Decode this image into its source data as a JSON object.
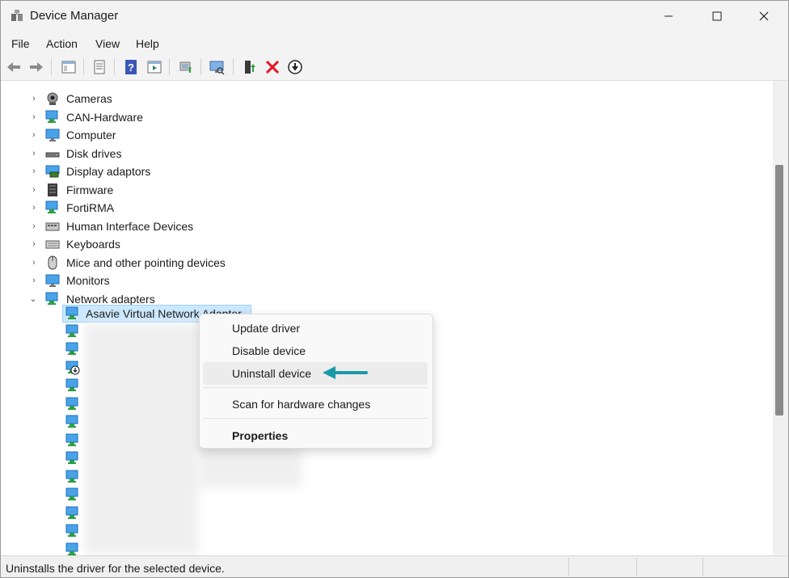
{
  "window": {
    "title": "Device Manager"
  },
  "menu": [
    "File",
    "Action",
    "View",
    "Help"
  ],
  "tree": {
    "categories": [
      {
        "label": "Cameras",
        "icon": "camera-icon"
      },
      {
        "label": "CAN-Hardware",
        "icon": "network-icon"
      },
      {
        "label": "Computer",
        "icon": "monitor-icon"
      },
      {
        "label": "Disk drives",
        "icon": "disk-icon"
      },
      {
        "label": "Display adaptors",
        "icon": "display-adapter-icon"
      },
      {
        "label": "Firmware",
        "icon": "chip-icon"
      },
      {
        "label": "FortiRMA",
        "icon": "network-icon"
      },
      {
        "label": "Human Interface Devices",
        "icon": "hid-icon"
      },
      {
        "label": "Keyboards",
        "icon": "keyboard-icon"
      },
      {
        "label": "Mice and other pointing devices",
        "icon": "mouse-icon"
      },
      {
        "label": "Monitors",
        "icon": "monitor-icon"
      },
      {
        "label": "Network adapters",
        "icon": "network-icon",
        "expanded": true
      }
    ],
    "selected_device": "Asavie Virtual Network Adapter"
  },
  "context_menu": {
    "update": "Update driver",
    "disable": "Disable device",
    "uninstall": "Uninstall device",
    "scan": "Scan for hardware changes",
    "properties": "Properties"
  },
  "status": "Uninstalls the driver for the selected device.",
  "colors": {
    "arrow": "#1a9aa8",
    "selection": "#cce8ff",
    "delete": "#e81123"
  }
}
